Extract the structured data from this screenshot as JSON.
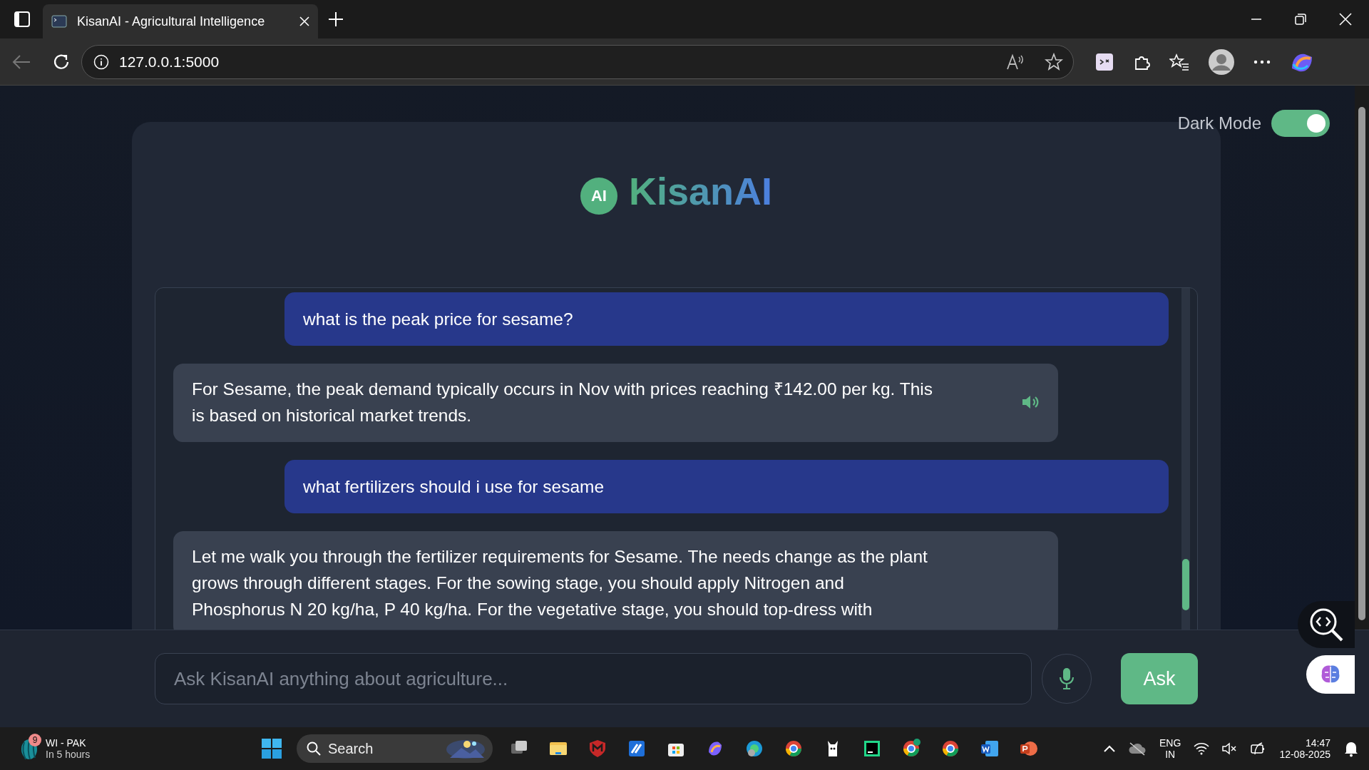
{
  "browser": {
    "tab_title": "KisanAI - Agricultural Intelligence",
    "url": "127.0.0.1:5000"
  },
  "dark_mode": {
    "label": "Dark Mode",
    "on": true
  },
  "header": {
    "logo": "AI",
    "title": "KisanAI"
  },
  "messages": [
    {
      "kind": "user",
      "text": "what is the peak price for sesame?"
    },
    {
      "kind": "bot",
      "speaker": true,
      "lines": [
        "For Sesame, the peak demand typically occurs in Nov with prices reaching ₹142.00 per kg. This",
        "is based on historical market trends."
      ]
    },
    {
      "kind": "user",
      "text": "what fertilizers should i use for sesame"
    },
    {
      "kind": "bot",
      "speaker": false,
      "lines": [
        "Let me walk you through the fertilizer requirements for Sesame. The needs change as the plant",
        "grows through different stages. For the sowing stage, you should apply Nitrogen and",
        "Phosphorus N 20 kg/ha, P 40 kg/ha. For the vegetative stage, you should top-dress with"
      ]
    }
  ],
  "input": {
    "placeholder": "Ask KisanAI anything about agriculture..."
  },
  "ask_button": "Ask",
  "taskbar": {
    "weather": {
      "badge": "9",
      "title": "WI - PAK",
      "subtitle": "In 5 hours"
    },
    "search": "Search",
    "language": [
      "ENG",
      "IN"
    ],
    "clock": {
      "time": "14:47",
      "date": "12-08-2025"
    }
  }
}
